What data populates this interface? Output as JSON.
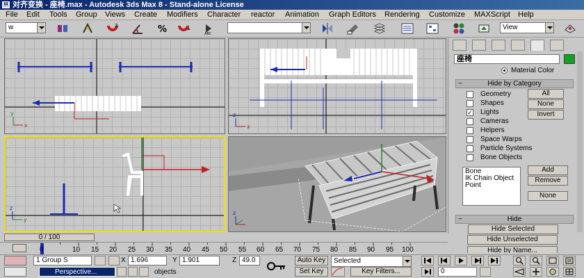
{
  "window": {
    "title": "对齐变换 - 座椅.max - Autodesk 3ds Max 8 - Stand-alone License"
  },
  "menu": [
    "File",
    "Edit",
    "Tools",
    "Group",
    "Views",
    "Create",
    "Modifiers",
    "Character",
    "reactor",
    "Animation",
    "Graph Editors",
    "Rendering",
    "Customize",
    "MAXScript",
    "Help"
  ],
  "toolbar": {
    "selection_filter": "w",
    "named_selection": "",
    "coord_system": "View",
    "icons": [
      "select-and-link-icon",
      "unlink-icon",
      "bind-space-warp-icon",
      "select-object-icon",
      "select-by-name-icon",
      "rect-region-icon",
      "move-icon",
      "rotate-icon",
      "scale-icon",
      "snap-icon",
      "angle-snap-icon",
      "percent-snap-icon",
      "spinner-snap-icon",
      "mirror-icon",
      "align-icon",
      "layer-manager-icon",
      "curve-editor-icon",
      "schematic-icon",
      "material-editor-icon",
      "render-setup-icon",
      "quick-render-icon"
    ]
  },
  "command_panel": {
    "object_name": "座椅",
    "object_color": "#12a020",
    "material_color_label": "Material Color",
    "hide_by_category": {
      "title": "Hide by Category",
      "categories": [
        {
          "label": "Geometry",
          "checked": false
        },
        {
          "label": "Shapes",
          "checked": false
        },
        {
          "label": "Lights",
          "checked": true
        },
        {
          "label": "Cameras",
          "checked": false
        },
        {
          "label": "Helpers",
          "checked": false
        },
        {
          "label": "Space Warps",
          "checked": false
        },
        {
          "label": "Particle Systems",
          "checked": false
        },
        {
          "label": "Bone Objects",
          "checked": false
        }
      ],
      "all_label": "All",
      "none_label": "None",
      "invert_label": "Invert",
      "list_items": [
        "Bone",
        "IK Chain Object",
        "Point"
      ],
      "add_label": "Add",
      "remove_label": "Remove",
      "none2_label": "None"
    },
    "hide": {
      "title": "Hide",
      "hide_selected": "Hide Selected",
      "hide_unselected": "Hide Unselected",
      "hide_by_name": "Hide by Name..."
    }
  },
  "timeline": {
    "slider_label": "0 / 100",
    "ticks": [
      "0",
      "10",
      "15",
      "20",
      "25",
      "30",
      "35",
      "40",
      "45",
      "50",
      "55",
      "60",
      "65",
      "70",
      "75",
      "80",
      "85",
      "90",
      "95",
      "100"
    ]
  },
  "status": {
    "selection_count": "1 Group S",
    "x_label": "X",
    "x_value": "1.696",
    "y_label": "Y",
    "y_value": "1.901",
    "z_label": "Z",
    "z_value": "49.0",
    "auto_key": "Auto Key",
    "set_key": "Set Key",
    "key_mode": "Selected",
    "key_filters": "Key Filters...",
    "frame": "0",
    "prompt": "objects",
    "taskbar_item": "Perspective..."
  }
}
